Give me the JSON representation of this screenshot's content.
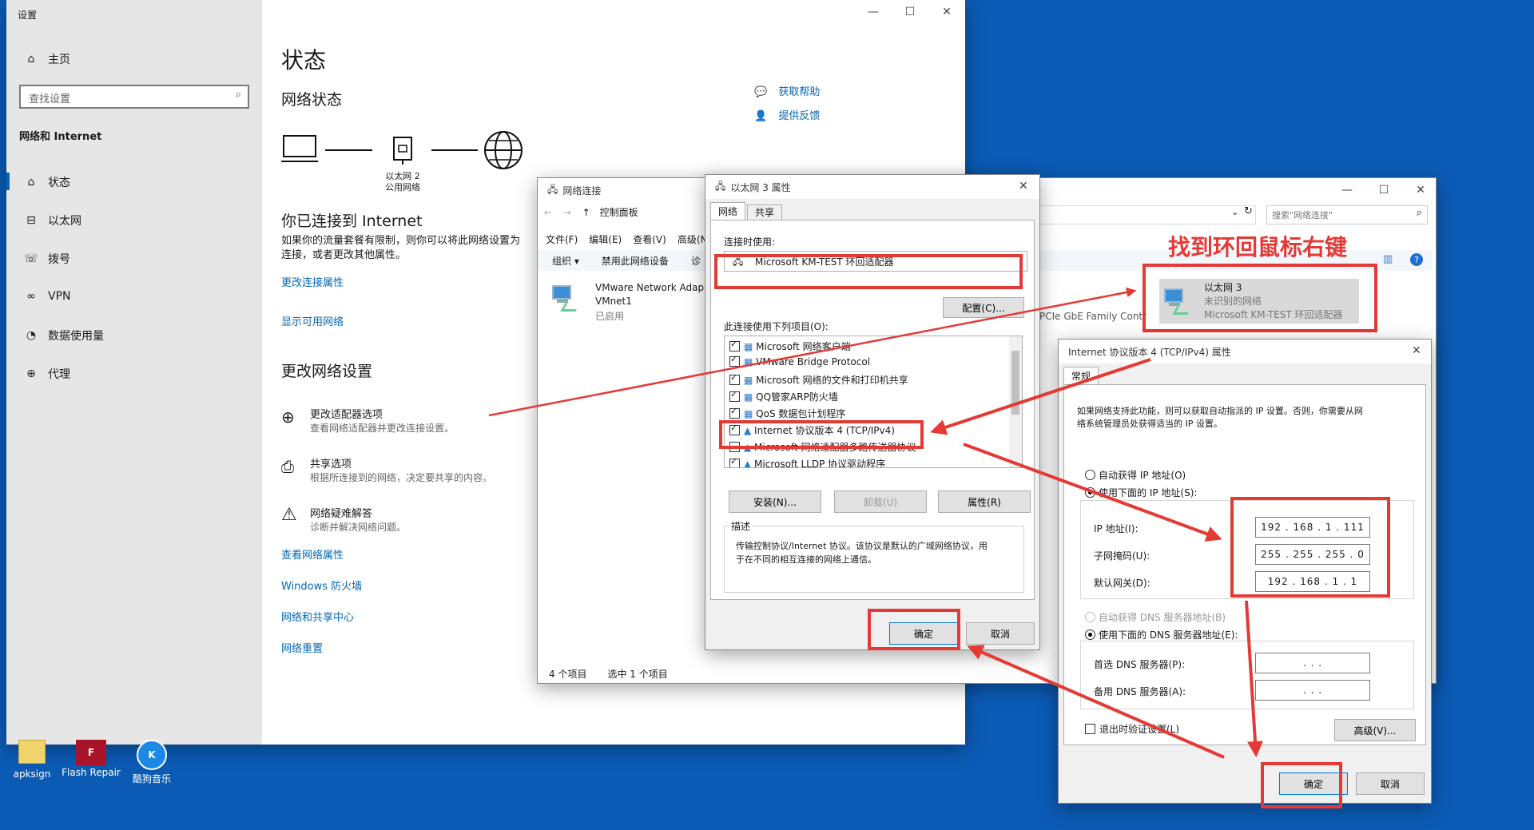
{
  "settings": {
    "title": "设置",
    "nav": {
      "home": "主页",
      "search_placeholder": "查找设置",
      "section": "网络和 Internet",
      "items": [
        {
          "label": "状态",
          "icon": "home-status-icon"
        },
        {
          "label": "以太网",
          "icon": "ethernet-icon"
        },
        {
          "label": "拨号",
          "icon": "dialup-icon"
        },
        {
          "label": "VPN",
          "icon": "vpn-icon"
        },
        {
          "label": "数据使用量",
          "icon": "data-usage-icon"
        },
        {
          "label": "代理",
          "icon": "proxy-globe-icon"
        }
      ]
    },
    "main": {
      "heading": "状态",
      "subheading": "网络状态",
      "diagram_label_line1": "以太网 2",
      "diagram_label_line2": "公用网络",
      "connected": "你已连接到 Internet",
      "connected_desc_1": "如果你的流量套餐有限制，则你可以将此网络设置为",
      "connected_desc_2": "连接，或者更改其他属性。",
      "link_change_props": "更改连接属性",
      "link_show_networks": "显示可用网络",
      "change_heading": "更改网络设置",
      "options": [
        {
          "title": "更改适配器选项",
          "desc": "查看网络适配器并更改连接设置。"
        },
        {
          "title": "共享选项",
          "desc": "根据所连接到的网络，决定要共享的内容。"
        },
        {
          "title": "网络疑难解答",
          "desc": "诊断并解决网络问题。"
        }
      ],
      "links": [
        "查看网络属性",
        "Windows 防火墙",
        "网络和共享中心",
        "网络重置"
      ],
      "help": "获取帮助",
      "feedback": "提供反馈"
    }
  },
  "netconn": {
    "title": "网络连接",
    "breadcrumb": "控制面板",
    "menu": [
      "文件(F)",
      "编辑(E)",
      "查看(V)",
      "高级(N"
    ],
    "toolbar": [
      "组织 ▾",
      "禁用此网络设备",
      "诊"
    ],
    "adapter1_name": "VMware Network Adap",
    "adapter1_sub": "VMnet1",
    "adapter1_status": "已启用",
    "status_items": "4 个项目",
    "status_selected": "选中 1 个项目",
    "search_placeholder": "搜索\"网络连接\"",
    "partial_text": "PCIe GbE Family Contr",
    "adapter3_name": "以太网 3",
    "adapter3_status": "未识别的网络",
    "adapter3_device": "Microsoft KM-TEST 环回适配器"
  },
  "props": {
    "title": "以太网 3 属性",
    "tabs": [
      "网络",
      "共享"
    ],
    "connect_using_label": "连接时使用:",
    "adapter": "Microsoft KM-TEST 环回适配器",
    "configure": "配置(C)...",
    "items_label": "此连接使用下列项目(O):",
    "items": [
      {
        "label": "Microsoft 网络客户端",
        "checked": true
      },
      {
        "label": "VMware Bridge Protocol",
        "checked": true
      },
      {
        "label": "Microsoft 网络的文件和打印机共享",
        "checked": true
      },
      {
        "label": "QQ管家ARP防火墙",
        "checked": true
      },
      {
        "label": "QoS 数据包计划程序",
        "checked": true
      },
      {
        "label": "Internet 协议版本 4 (TCP/IPv4)",
        "checked": true
      },
      {
        "label": "Microsoft 网络适配器多路传送器协议",
        "checked": false
      },
      {
        "label": "Microsoft LLDP 协议驱动程序",
        "checked": true
      }
    ],
    "install": "安装(N)...",
    "uninstall": "卸载(U)",
    "properties": "属性(R)",
    "desc_label": "描述",
    "desc_text_1": "传输控制协议/Internet 协议。该协议是默认的广域网络协议，用",
    "desc_text_2": "于在不同的相互连接的网络上通信。",
    "ok": "确定",
    "cancel": "取消"
  },
  "ipv4": {
    "title": "Internet 协议版本 4 (TCP/IPv4) 属性",
    "tab": "常规",
    "intro_1": "如果网络支持此功能，则可以获取自动指派的 IP 设置。否则，你需要从网",
    "intro_2": "络系统管理员处获得适当的 IP 设置。",
    "auto_ip": "自动获得 IP 地址(O)",
    "manual_ip": "使用下面的 IP 地址(S):",
    "ip_label": "IP 地址(I):",
    "ip_value": "192 . 168 .  1  . 111",
    "mask_label": "子网掩码(U):",
    "mask_value": "255 . 255 . 255 .  0",
    "gw_label": "默认网关(D):",
    "gw_value": "192 . 168 .  1  .  1",
    "auto_dns": "自动获得 DNS 服务器地址(B)",
    "manual_dns": "使用下面的 DNS 服务器地址(E):",
    "dns1_label": "首选 DNS 服务器(P):",
    "dns2_label": "备用 DNS 服务器(A):",
    "dns_empty": ".       .       .",
    "validate": "退出时验证设置(L)",
    "advanced": "高级(V)...",
    "ok": "确定",
    "cancel": "取消"
  },
  "annotation": {
    "text": "找到环回鼠标右键",
    "color": "#e53935"
  },
  "desktop": {
    "icons": [
      {
        "label": "apksign",
        "icon": "apksign-folder-icon"
      },
      {
        "label": "Flash Repair",
        "icon": "flash-repair-icon"
      },
      {
        "label": "酷狗音乐",
        "icon": "kugou-music-icon"
      }
    ]
  }
}
